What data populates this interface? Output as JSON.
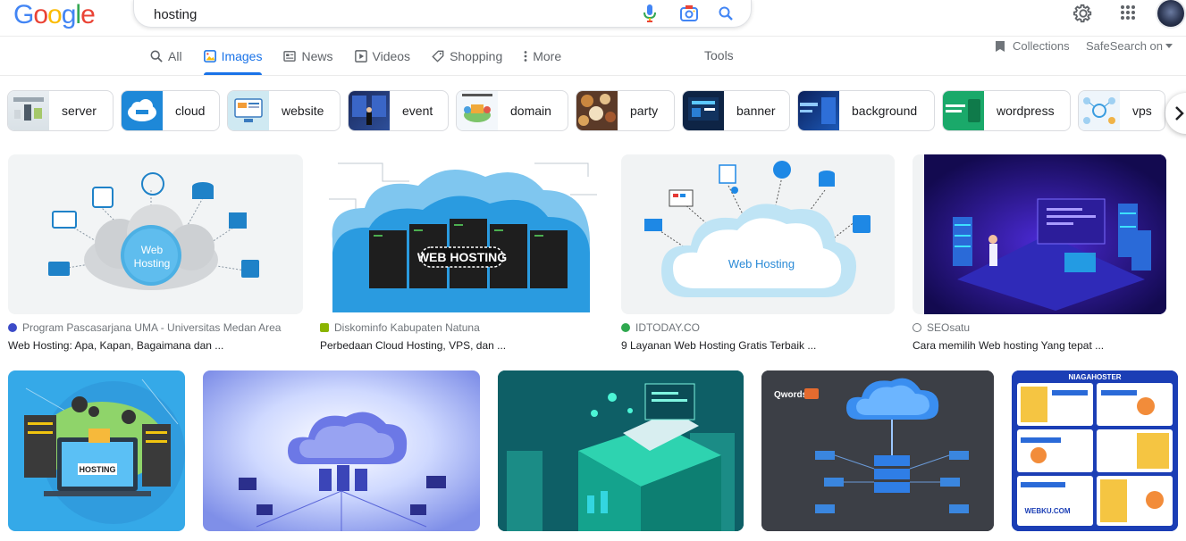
{
  "search": {
    "query": "hosting"
  },
  "logo": {
    "letters": [
      "G",
      "o",
      "o",
      "g",
      "l",
      "e"
    ],
    "colors": [
      "#4285F4",
      "#EA4335",
      "#FBBC05",
      "#4285F4",
      "#34A853",
      "#EA4335"
    ]
  },
  "tabs": [
    {
      "label": "All",
      "icon": "search-icon"
    },
    {
      "label": "Images",
      "icon": "image-icon",
      "active": true
    },
    {
      "label": "News",
      "icon": "news-icon"
    },
    {
      "label": "Videos",
      "icon": "video-icon"
    },
    {
      "label": "Shopping",
      "icon": "tag-icon"
    },
    {
      "label": "More",
      "icon": "more-vert-icon"
    }
  ],
  "tools_label": "Tools",
  "collections_label": "Collections",
  "safesearch_label": "SafeSearch on",
  "chips": [
    "server",
    "cloud",
    "website",
    "event",
    "domain",
    "party",
    "banner",
    "background",
    "wordpress",
    "vps"
  ],
  "results": [
    {
      "source": "Program Pascasarjana UMA - Universitas Medan Area",
      "title": "Web Hosting: Apa, Kapan, Bagaimana dan ...",
      "fav": "#3c4bc8",
      "img_text": "Web Hosting"
    },
    {
      "source": "Diskominfo Kabupaten Natuna",
      "title": "Perbedaan Cloud Hosting, VPS, dan ...",
      "fav": "#8ab400",
      "img_text": "WEB HOSTING"
    },
    {
      "source": "IDTODAY.CO",
      "title": "9 Layanan Web Hosting Gratis Terbaik ...",
      "fav": "#2fa84f",
      "img_text": "Web Hosting"
    },
    {
      "source": "SEOsatu",
      "title": "Cara memilih Web hosting Yang tepat ...",
      "fav": "#70757a",
      "img_text": ""
    }
  ],
  "row2_labels": {
    "hosting": "HOSTING",
    "qwords": "Qwords",
    "niagahoster": "NIAGAHOSTER",
    "webku": "WEBKU.COM"
  },
  "colors": {
    "accent": "#1a73e8"
  }
}
